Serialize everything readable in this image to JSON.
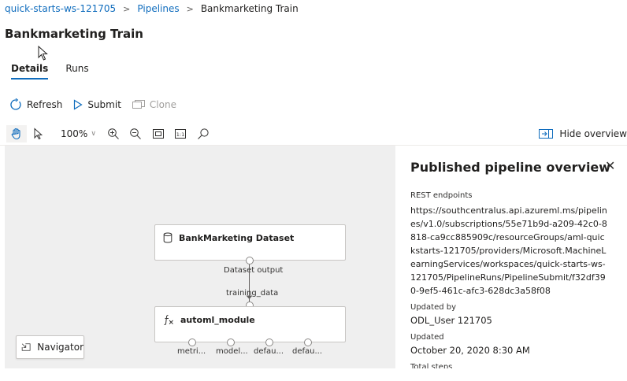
{
  "breadcrumb": {
    "workspace": "quick-starts-ws-121705",
    "pipelines": "Pipelines",
    "current": "Bankmarketing Train"
  },
  "page_title": "Bankmarketing Train",
  "tabs": [
    {
      "label": "Details",
      "active": true
    },
    {
      "label": "Runs",
      "active": false
    }
  ],
  "commands": {
    "refresh": "Refresh",
    "submit": "Submit",
    "clone": "Clone"
  },
  "graph_toolbar": {
    "zoom": "100%",
    "fit_label": "1:1",
    "hide_overview": "Hide overview",
    "icons": [
      "hand-pan-icon",
      "pointer-select-icon",
      "zoom-in-icon",
      "zoom-out-icon",
      "fit-to-screen-icon",
      "actual-size-icon",
      "search-icon",
      "hide-overview-icon"
    ]
  },
  "canvas": {
    "dataset_node": {
      "title": "BankMarketing Dataset",
      "output_port": "Dataset output"
    },
    "automl_node": {
      "input_port": "training_data",
      "title": "automl_module",
      "output_ports": [
        "metri...",
        "model...",
        "defau...",
        "defau..."
      ]
    },
    "navigator": "Navigator"
  },
  "overview": {
    "title": "Published pipeline overview",
    "rest_label": "REST endpoints",
    "rest_value": "https://southcentralus.api.azureml.ms/pipelines/v1.0/subscriptions/55e71b9d-a209-42c0-8818-ca9cc885909c/resourceGroups/aml-quickstarts-121705/providers/Microsoft.MachineLearningServices/workspaces/quick-starts-ws-121705/PipelineRuns/PipelineSubmit/f32df390-9ef5-461c-afc3-628dc3a58f08",
    "updated_by_label": "Updated by",
    "updated_by_value": "ODL_User 121705",
    "updated_label": "Updated",
    "updated_value": "October 20, 2020 8:30 AM",
    "total_steps_label": "Total steps"
  },
  "colors": {
    "accent": "#0f6cbd",
    "canvas_bg": "#efefef",
    "disabled": "#a19f9d"
  }
}
